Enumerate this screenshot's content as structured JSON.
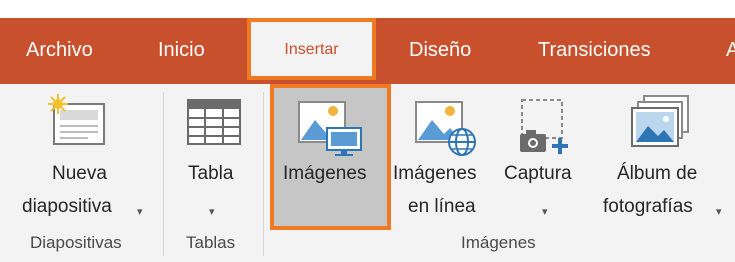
{
  "tabs": {
    "archivo": "Archivo",
    "inicio": "Inicio",
    "insertar": "Insertar",
    "diseno": "Diseño",
    "transiciones": "Transiciones",
    "cut": "A"
  },
  "ribbon": {
    "nueva_line1": "Nueva",
    "nueva_line2": "diapositiva",
    "tabla": "Tabla",
    "imagenes": "Imágenes",
    "imagenes_linea_line1": "Imágenes",
    "imagenes_linea_line2": "en línea",
    "captura": "Captura",
    "album_line1": "Álbum de",
    "album_line2": "fotografías",
    "dropdown_glyph": "▾",
    "groups": {
      "diapositivas": "Diapositivas",
      "tablas": "Tablas",
      "imagenes": "Imágenes"
    }
  },
  "colors": {
    "tab_bar": "#c9502d",
    "highlight": "#f07a24",
    "ribbon_bg": "#f3f3f3",
    "selected_button": "#c6c6c6"
  }
}
